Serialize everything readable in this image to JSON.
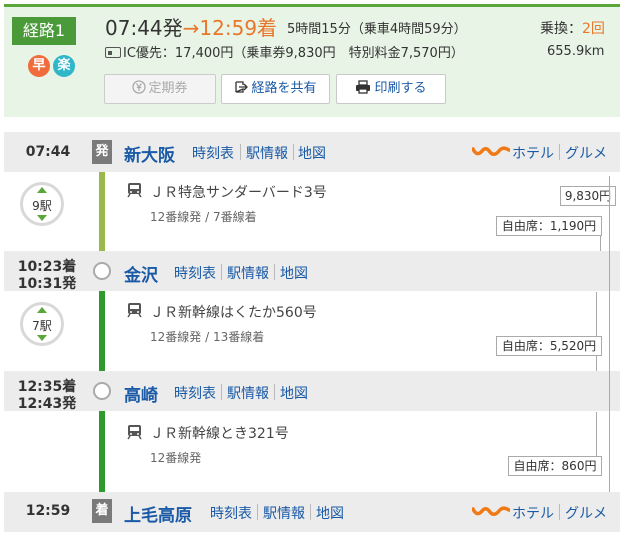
{
  "summary": {
    "route_label": "経路1",
    "badge_fast": "早",
    "badge_easy": "楽",
    "depart_time": "07:44発",
    "arrow": "→",
    "arrive_time": "12:59着",
    "duration": "5時間15分（乗車4時間59分）",
    "fare": "IC優先：17,400円（乗車券9,830円　特別料金7,570円）",
    "transfer_label": "乗換：",
    "transfer_count": "2回",
    "distance": "655.9km",
    "buttons": {
      "pass": "定期券",
      "share": "経路を共有",
      "print": "印刷する"
    }
  },
  "links": {
    "timetable": "時刻表",
    "station_info": "駅情報",
    "map": "地図",
    "hotel": "ホテル",
    "gourmet": "グルメ"
  },
  "tags": {
    "depart": "発",
    "arrive": "着"
  },
  "stations": [
    {
      "name": "新大阪",
      "time1": "07:44",
      "time2": ""
    },
    {
      "name": "金沢",
      "time1": "10:23着",
      "time2": "10:31発"
    },
    {
      "name": "高崎",
      "time1": "12:35着",
      "time2": "12:43発"
    },
    {
      "name": "上毛高原",
      "time1": "12:59",
      "time2": ""
    }
  ],
  "segments": [
    {
      "train": "ＪＲ特急サンダーバード3号",
      "track": "12番線発 / 7番線着",
      "stops": "9駅",
      "seat": "自由席：1,190円",
      "line_color": "#9ab84c"
    },
    {
      "train": "ＪＲ新幹線はくたか560号",
      "track": "12番線発 / 13番線着",
      "stops": "7駅",
      "seat": "自由席：5,520円",
      "line_color": "#2e9a2e"
    },
    {
      "train": "ＪＲ新幹線とき321号",
      "track": "12番線発",
      "stops": "",
      "seat": "自由席：860円",
      "line_color": "#2e9a2e"
    }
  ],
  "base_fare": "9,830円"
}
